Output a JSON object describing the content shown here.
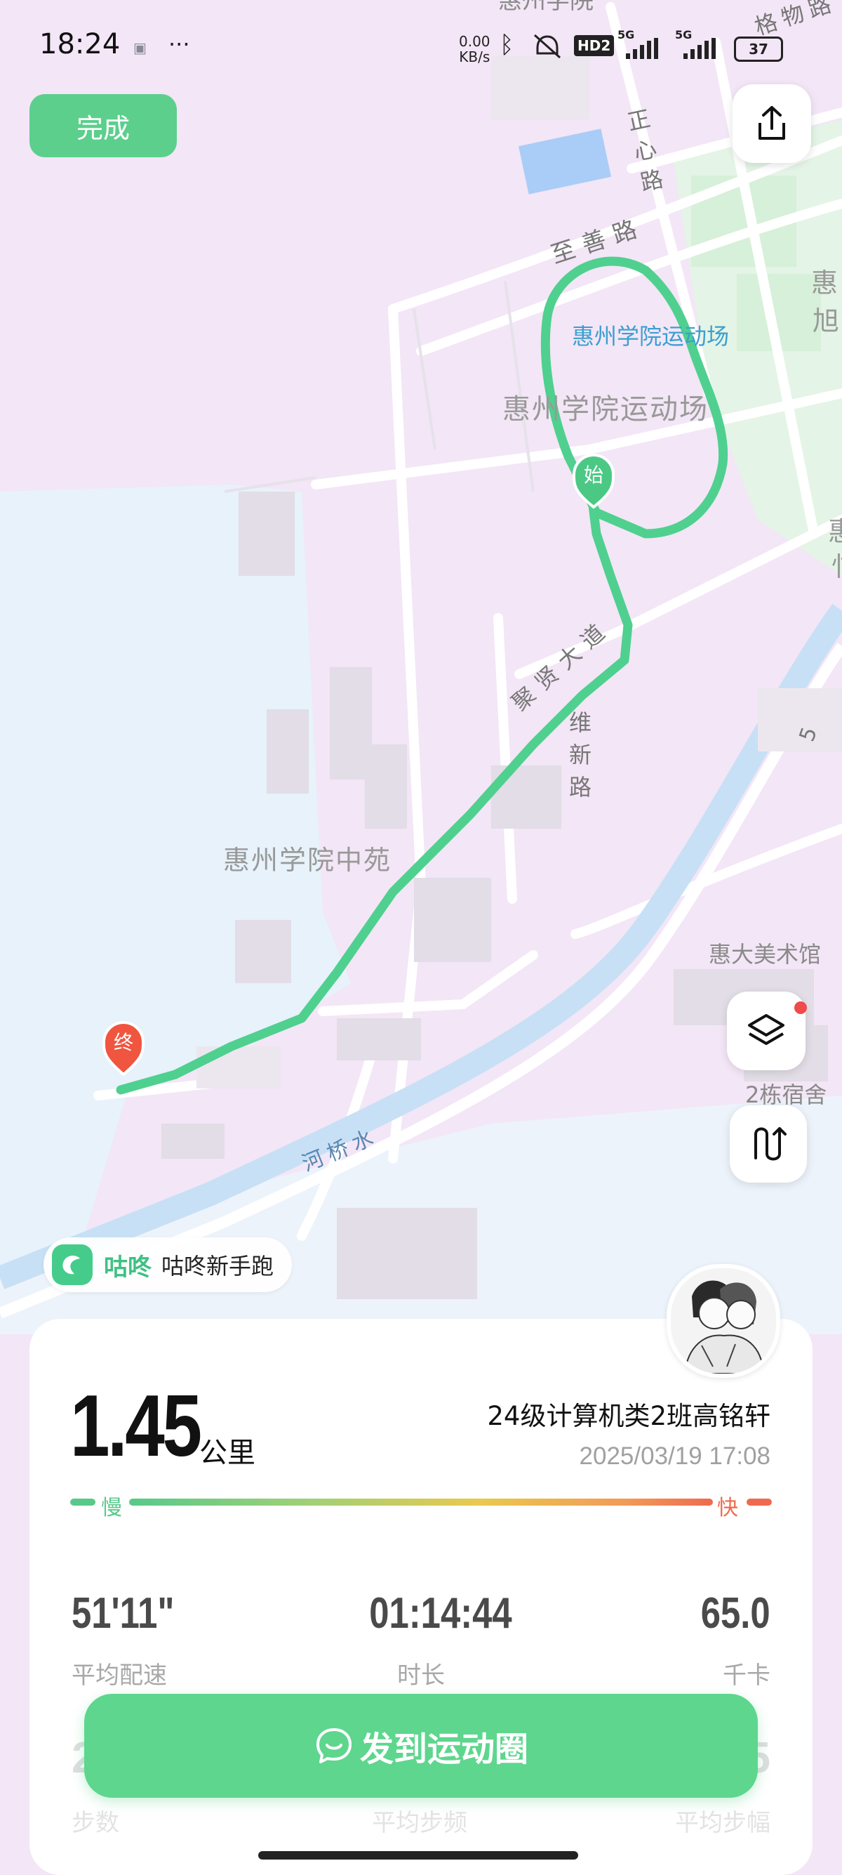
{
  "status_bar": {
    "time": "18:24",
    "net_speed_value": "0.00",
    "net_speed_unit": "KB/s",
    "signal_1": "5G",
    "signal_2": "5G",
    "hd_label": "HD2",
    "battery": "37"
  },
  "toolbar": {
    "done_label": "完成"
  },
  "map": {
    "labels": {
      "campus_top": "惠州学院",
      "zhengxin_road": "正心路",
      "gewu_road": "格物路",
      "zhishan_road": "至善路",
      "stadium_blue": "惠州学院运动场",
      "stadium_gray": "惠州学院运动场",
      "right_hui_1": "惠",
      "right_xu": "旭",
      "right_hui_2": "惠",
      "right_yi": "忄",
      "juxian_road": "聚贤大道",
      "weixin_road": "维新路",
      "zhongyuan": "惠州学院中苑",
      "art_museum": "惠大美术馆",
      "dorm": "2栋宿舍",
      "river": "河桥水",
      "road_num": "5"
    },
    "start_marker": "始",
    "end_marker": "终"
  },
  "app_tag": {
    "brand": "咕咚",
    "text": "咕咚新手跑"
  },
  "workout": {
    "distance": "1.45",
    "distance_unit": "公里",
    "user_name": "24级计算机类2班高铭轩",
    "datetime": "2025/03/19 17:08",
    "pace_slow_label": "慢",
    "pace_fast_label": "快",
    "stats": [
      {
        "value": "51'11\"",
        "label": "平均配速"
      },
      {
        "value": "01:14:44",
        "label": "时长"
      },
      {
        "value": "65.0",
        "label": "千卡"
      }
    ],
    "stats_row2": [
      {
        "value": "2",
        "label": "步数"
      },
      {
        "value": "",
        "label": "平均步频"
      },
      {
        "value": "5",
        "label": "平均步幅"
      }
    ]
  },
  "actions": {
    "share_label": "发到运动圈"
  },
  "colors": {
    "accent": "#5ccf8d",
    "track": "#4fd08f",
    "slow": "#58c98a",
    "fast": "#ef6a4e"
  }
}
